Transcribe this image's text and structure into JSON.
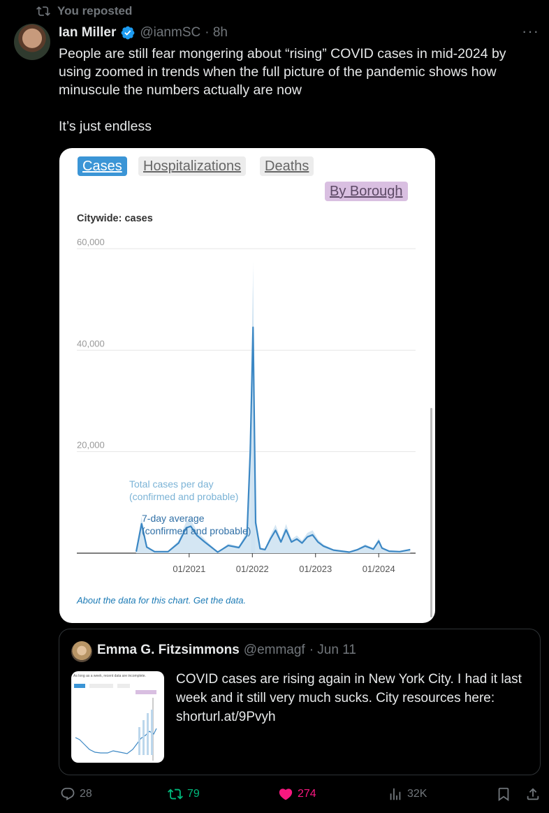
{
  "repost": {
    "label": "You reposted"
  },
  "tweet": {
    "author_name": "Ian Miller",
    "handle": "@ianmSC",
    "time": "· 8h",
    "text": "People are still fear mongering about “rising” COVID cases in mid-2024 by using zoomed in trends when the full picture of the pandemic shows how minuscule the numbers actually are now\n\nIt’s just endless"
  },
  "chart": {
    "tabs": {
      "cases": "Cases",
      "hospitalizations": "Hospitalizations",
      "deaths": "Deaths",
      "by_borough": "By Borough"
    },
    "title": "Citywide: cases",
    "footer": "About the data for this chart. Get the data.",
    "annotation_total": [
      "Total cases per day",
      "(confirmed and probable)"
    ],
    "annotation_avg": [
      "7-day average",
      "(confirmed and probable)"
    ]
  },
  "chart_data": {
    "type": "line",
    "title": "Citywide: cases",
    "x_ticks": [
      "01/2021",
      "01/2022",
      "01/2023",
      "01/2024"
    ],
    "y_ticks": [
      "60,000",
      "40,000",
      "20,000"
    ],
    "ylim": [
      0,
      60000
    ],
    "series": [
      {
        "name": "7-day average (confirmed and probable)",
        "x": [
          "2020-03-01",
          "2020-04-01",
          "2020-05-01",
          "2020-06-15",
          "2020-09-01",
          "2020-11-01",
          "2020-12-15",
          "2021-01-10",
          "2021-02-15",
          "2021-04-01",
          "2021-06-15",
          "2021-08-15",
          "2021-10-15",
          "2021-12-01",
          "2021-12-20",
          "2022-01-05",
          "2022-01-20",
          "2022-02-15",
          "2022-03-15",
          "2022-04-15",
          "2022-05-15",
          "2022-06-15",
          "2022-07-15",
          "2022-08-15",
          "2022-09-15",
          "2022-10-15",
          "2022-11-15",
          "2022-12-15",
          "2023-01-15",
          "2023-02-15",
          "2023-04-15",
          "2023-07-15",
          "2023-09-01",
          "2023-10-15",
          "2023-12-01",
          "2024-01-01",
          "2024-01-20",
          "2024-03-01",
          "2024-05-01",
          "2024-07-01"
        ],
        "values": [
          300,
          5800,
          1200,
          300,
          300,
          2000,
          5000,
          5300,
          3500,
          2200,
          200,
          1500,
          1100,
          3500,
          20000,
          44500,
          6000,
          900,
          700,
          2800,
          4500,
          2200,
          4600,
          2200,
          2800,
          2000,
          3200,
          3600,
          2200,
          1400,
          600,
          200,
          700,
          1400,
          800,
          2400,
          1000,
          400,
          300,
          700
        ]
      }
    ]
  },
  "quote": {
    "author_name": "Emma G. Fitzsimmons",
    "handle": "@emmagf",
    "time": "· Jun 11",
    "text": "COVID cases are rising again in New York City. I had it last week and it still very much sucks. City resources here: shorturl.at/9Pvyh",
    "thumb_note": "As long as a week, recent data are incomplete."
  },
  "actions": {
    "replies": "28",
    "reposts": "79",
    "likes": "274",
    "views": "32K"
  },
  "colors": {
    "repost_green": "#00ba7c",
    "like_pink": "#f91880",
    "verified_blue": "#1d9bf0",
    "series_blue": "#3b87c4"
  }
}
